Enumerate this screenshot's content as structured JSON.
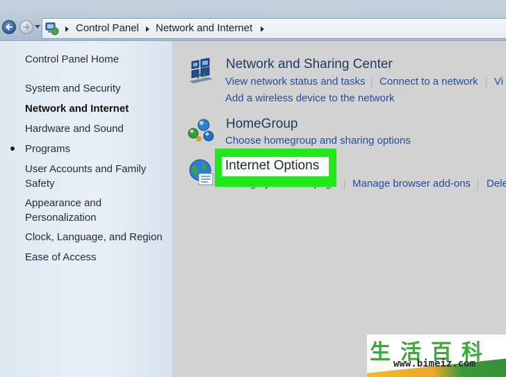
{
  "breadcrumb": {
    "items": [
      "Control Panel",
      "Network and Internet"
    ]
  },
  "left_pane": {
    "home": "Control Panel Home",
    "items": [
      "System and Security",
      "Network and Internet",
      "Hardware and Sound",
      "Programs",
      "User Accounts and Family Safety",
      "Appearance and Personalization",
      "Clock, Language, and Region",
      "Ease of Access"
    ],
    "current_index": 1
  },
  "categories": {
    "sharing": {
      "title": "Network and Sharing Center",
      "links": [
        "View network status and tasks",
        "Connect to a network",
        "Vi"
      ],
      "link2": "Add a wireless device to the network"
    },
    "homegroup": {
      "title": "HomeGroup",
      "links": [
        "Choose homegroup and sharing options"
      ]
    },
    "internet_options": {
      "title": "Internet Options",
      "links": [
        "Change your homepage",
        "Manage browser add-ons",
        "Dele"
      ],
      "highlight_color": "#1fe81b"
    }
  },
  "watermark": {
    "chars": "生活百科",
    "url": "www.bimeiz.com"
  },
  "colors": {
    "link": "#1f4e9c",
    "title": "#1e395b",
    "highlight": "#1fe81b"
  }
}
